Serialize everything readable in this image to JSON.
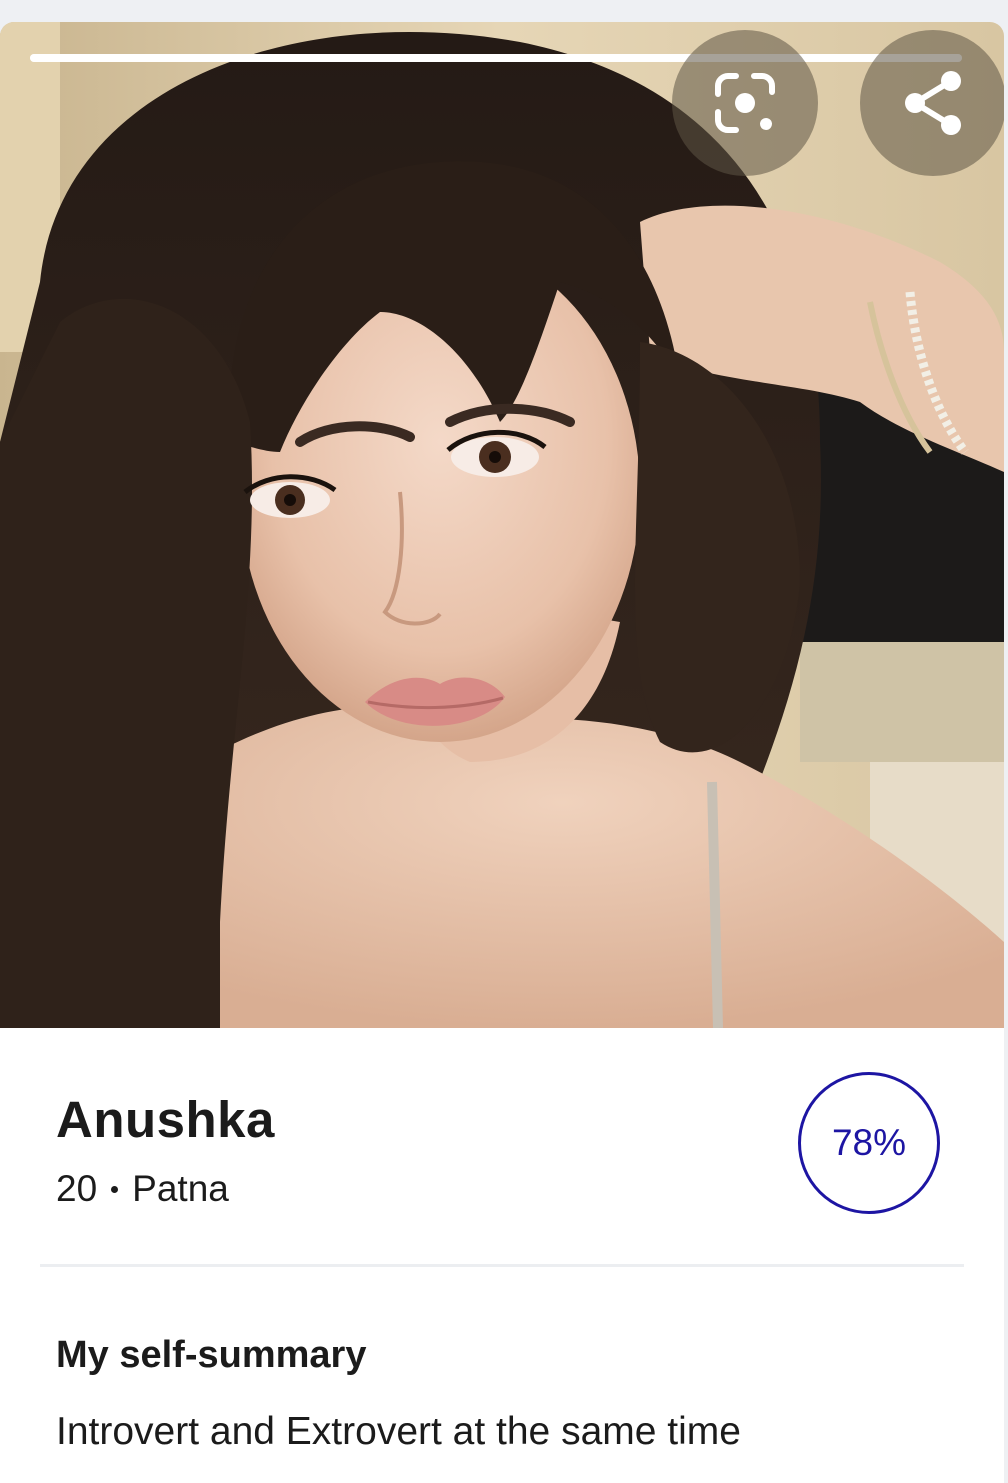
{
  "photo": {
    "alt": "Profile photo of Anushka",
    "progress_fraction": 1.0
  },
  "actions": {
    "lens_icon": "google-lens-icon",
    "share_icon": "share-icon"
  },
  "profile": {
    "name": "Anushka",
    "age": "20",
    "location": "Patna",
    "match_percent": "78%"
  },
  "self_summary": {
    "title": "My self-summary",
    "text": "Introvert and Extrovert at the same time"
  },
  "colors": {
    "accent": "#1d15a3",
    "text": "#1b1b1b",
    "divider": "#eceef1"
  }
}
